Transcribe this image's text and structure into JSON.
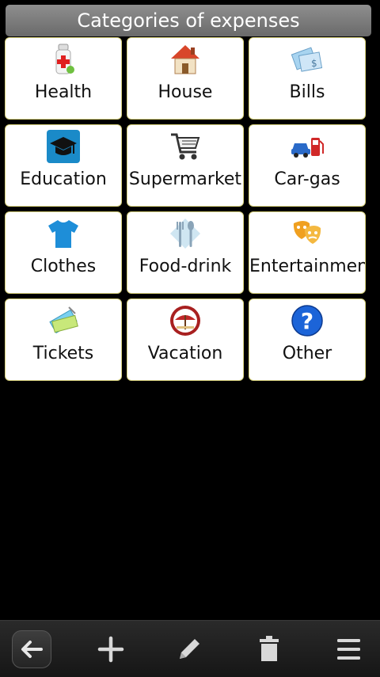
{
  "header": {
    "title": "Categories of expenses"
  },
  "categories": [
    {
      "label": "Health",
      "icon": "medicine-bottle-icon"
    },
    {
      "label": "House",
      "icon": "house-icon"
    },
    {
      "label": "Bills",
      "icon": "bill-icon"
    },
    {
      "label": "Education",
      "icon": "graduation-cap-icon"
    },
    {
      "label": "Supermarket",
      "icon": "shopping-cart-icon"
    },
    {
      "label": "Car-gas",
      "icon": "car-gas-icon"
    },
    {
      "label": "Clothes",
      "icon": "tshirt-icon"
    },
    {
      "label": "Food-drink",
      "icon": "fork-spoon-icon"
    },
    {
      "label": "Entertainment",
      "icon": "theater-masks-icon"
    },
    {
      "label": "Tickets",
      "icon": "ticket-icon"
    },
    {
      "label": "Vacation",
      "icon": "beach-umbrella-icon"
    },
    {
      "label": "Other",
      "icon": "question-mark-icon"
    }
  ],
  "toolbar": {
    "items": [
      "back-arrow-icon",
      "add-icon",
      "edit-pencil-icon",
      "delete-trash-icon",
      "menu-icon"
    ]
  }
}
